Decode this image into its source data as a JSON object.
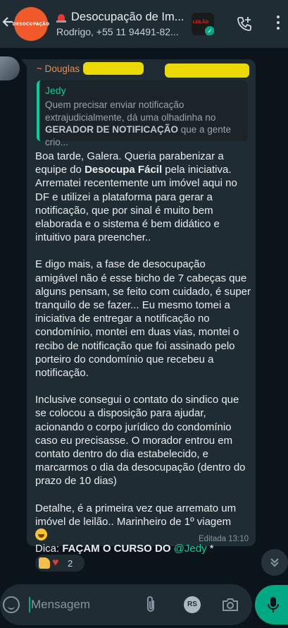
{
  "header": {
    "group_avatar_text": "DESOCUPAÇÃO",
    "title": "Desocupação de Im...",
    "subtitle": "Rodrigo, +55 11 94491-82...",
    "video_thumb_text": "LEILÃO",
    "icons": [
      "back-arrow-icon",
      "siren-icon",
      "add-call-icon",
      "more-vert-icon"
    ]
  },
  "message": {
    "sender": "~ Douglas",
    "quote": {
      "author": "Jedy",
      "text_before": "Quem precisar enviar notificação extrajudicialmente, dá uma olhadinha no ",
      "text_bold": "GERADOR DE NOTIFICAÇÃO",
      "text_after": " que a gente crio..."
    },
    "p1_before": "Boa tarde, Galera. Queria parabenizar a equipe do ",
    "p1_bold": "Desocupa Fácil",
    "p1_after": " pela iniciativa. Arrematei recentemente um imóvel aqui no DF e utilizei a plataforma para gerar a notificação, que por sinal é muito bem elaborada e o sistema é bem didático e intuitivo para preencher..",
    "p2": "E digo mais, a fase de desocupação amigável não é esse bicho de 7 cabeças que alguns pensam, se feito com cuidado, é super tranquilo de se fazer... Eu mesmo tomei a iniciativa de entregar a notificação no condomínio, montei em duas vias, montei o recibo de notificação que foi assinado pelo porteiro do condomínio que recebeu a notificação.",
    "p3": "Inclusive consegui o contato do sindico que se colocou a disposição para ajudar, acionando o corpo jurídico do condomínio caso eu precisasse. O morador entrou em contato dentro do dia estabelecido, e marcarmos o dia da desocupação (dentro do prazo de 10 dias)",
    "p4": "Detalhe, é a primeira vez que arremato um imóvel de leilão.. Marinheiro de 1º viagem",
    "dica_label": "Dica: ",
    "dica_bold": "FAÇAM O CURSO DO",
    "dica_mention": "@Jedy",
    "dica_end": " *",
    "edited_label": "Editada",
    "time": "13:10",
    "reactions_count": "2"
  },
  "input": {
    "placeholder": "Mensagem",
    "rs_label": "RS"
  },
  "colors": {
    "accent": "#00a884",
    "sender_name": "#f08a4b",
    "quote_author": "#06cf9c",
    "bubble": "#202c33",
    "header": "#1f2c34",
    "background": "#0b141a"
  }
}
